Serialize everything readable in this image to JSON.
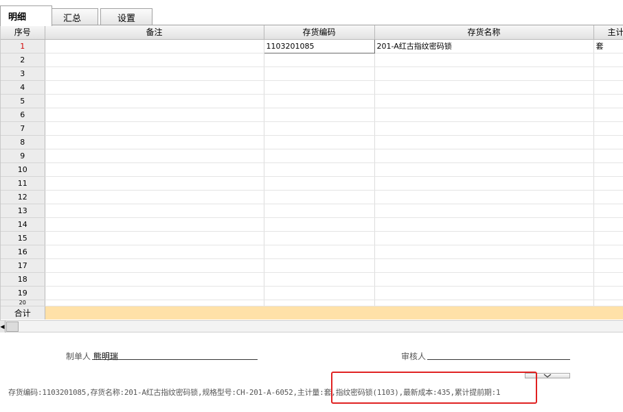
{
  "tabs": [
    "明细",
    "汇总",
    "设置"
  ],
  "columns": [
    "序号",
    "备注",
    "存货编码",
    "存货名称",
    "主计"
  ],
  "rows": [
    {
      "n": "1",
      "remark": "",
      "code": "1103201085",
      "name": "201-A红古指纹密码锁",
      "unit": "套"
    },
    {
      "n": "2",
      "remark": "",
      "code": "",
      "name": "",
      "unit": ""
    },
    {
      "n": "3",
      "remark": "",
      "code": "",
      "name": "",
      "unit": ""
    },
    {
      "n": "4",
      "remark": "",
      "code": "",
      "name": "",
      "unit": ""
    },
    {
      "n": "5",
      "remark": "",
      "code": "",
      "name": "",
      "unit": ""
    },
    {
      "n": "6",
      "remark": "",
      "code": "",
      "name": "",
      "unit": ""
    },
    {
      "n": "7",
      "remark": "",
      "code": "",
      "name": "",
      "unit": ""
    },
    {
      "n": "8",
      "remark": "",
      "code": "",
      "name": "",
      "unit": ""
    },
    {
      "n": "9",
      "remark": "",
      "code": "",
      "name": "",
      "unit": ""
    },
    {
      "n": "10",
      "remark": "",
      "code": "",
      "name": "",
      "unit": ""
    },
    {
      "n": "11",
      "remark": "",
      "code": "",
      "name": "",
      "unit": ""
    },
    {
      "n": "12",
      "remark": "",
      "code": "",
      "name": "",
      "unit": ""
    },
    {
      "n": "13",
      "remark": "",
      "code": "",
      "name": "",
      "unit": ""
    },
    {
      "n": "14",
      "remark": "",
      "code": "",
      "name": "",
      "unit": ""
    },
    {
      "n": "15",
      "remark": "",
      "code": "",
      "name": "",
      "unit": ""
    },
    {
      "n": "16",
      "remark": "",
      "code": "",
      "name": "",
      "unit": ""
    },
    {
      "n": "17",
      "remark": "",
      "code": "",
      "name": "",
      "unit": ""
    },
    {
      "n": "18",
      "remark": "",
      "code": "",
      "name": "",
      "unit": ""
    },
    {
      "n": "19",
      "remark": "",
      "code": "",
      "name": "",
      "unit": ""
    },
    {
      "n": "20",
      "remark": "",
      "code": "",
      "name": "",
      "unit": ""
    }
  ],
  "total_label": "合计",
  "footer": {
    "maker_label": "制单人",
    "maker_name": "熊明瑞",
    "checker_label": "审核人",
    "checker_name": ""
  },
  "status_text": "存货编码:1103201085,存货名称:201-A红古指纹密码锁,规格型号:CH-201-A-6052,主计量:套,指纹密码锁(1103),最新成本:435,累计提前期:1",
  "colors": {
    "total_row": "#ffe1a8",
    "highlight": "#e02020",
    "first_row_number": "#d00000"
  }
}
